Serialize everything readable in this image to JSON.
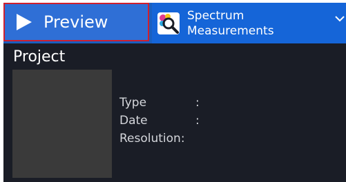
{
  "toolbar": {
    "preview_label": "Preview",
    "spectrum_label": "Spectrum\nMeasurements",
    "preview_icon": "play-icon",
    "spectrum_icon": "magnifier-color-icon",
    "dropdown_icon": "chevron-down-icon",
    "highlight_color": "#cf1f2e",
    "accent_color": "#1565d8"
  },
  "project": {
    "title": "Project",
    "fields": [
      {
        "key": "Type",
        "sep": ":"
      },
      {
        "key": "Date",
        "sep": ":"
      },
      {
        "key": "Resolution",
        "sep": ":"
      }
    ]
  }
}
